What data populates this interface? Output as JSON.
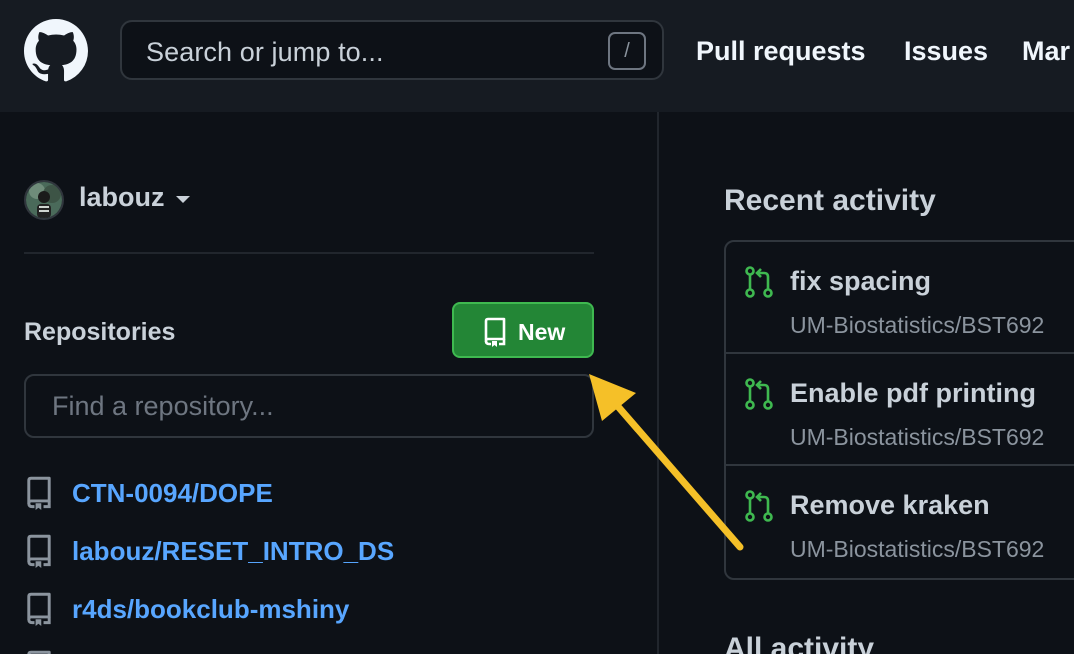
{
  "header": {
    "search_placeholder": "Search or jump to...",
    "search_shortcut": "/",
    "nav": [
      "Pull requests",
      "Issues",
      "Mar"
    ]
  },
  "sidebar": {
    "username": "labouz",
    "repositories_title": "Repositories",
    "new_button_label": "New",
    "find_placeholder": "Find a repository...",
    "repos": [
      "CTN-0094/DOPE",
      "labouz/RESET_INTRO_DS",
      "r4ds/bookclub-mshiny"
    ]
  },
  "main": {
    "recent_activity_title": "Recent activity",
    "activity": [
      {
        "title": "fix spacing",
        "repo": "UM-Biostatistics/BST692"
      },
      {
        "title": "Enable pdf printing",
        "repo": "UM-Biostatistics/BST692"
      },
      {
        "title": "Remove kraken",
        "repo": "UM-Biostatistics/BST692"
      }
    ],
    "all_activity_title": "All activity"
  },
  "colors": {
    "background": "#0d1117",
    "header": "#161b22",
    "link": "#58a6ff",
    "new_button": "#238636",
    "pr_icon": "#3fb950",
    "annotation_arrow": "#f5c028"
  },
  "icons": {
    "logo": "github-logo-icon",
    "repo": "repo-icon",
    "pull_request": "git-pull-request-icon"
  }
}
